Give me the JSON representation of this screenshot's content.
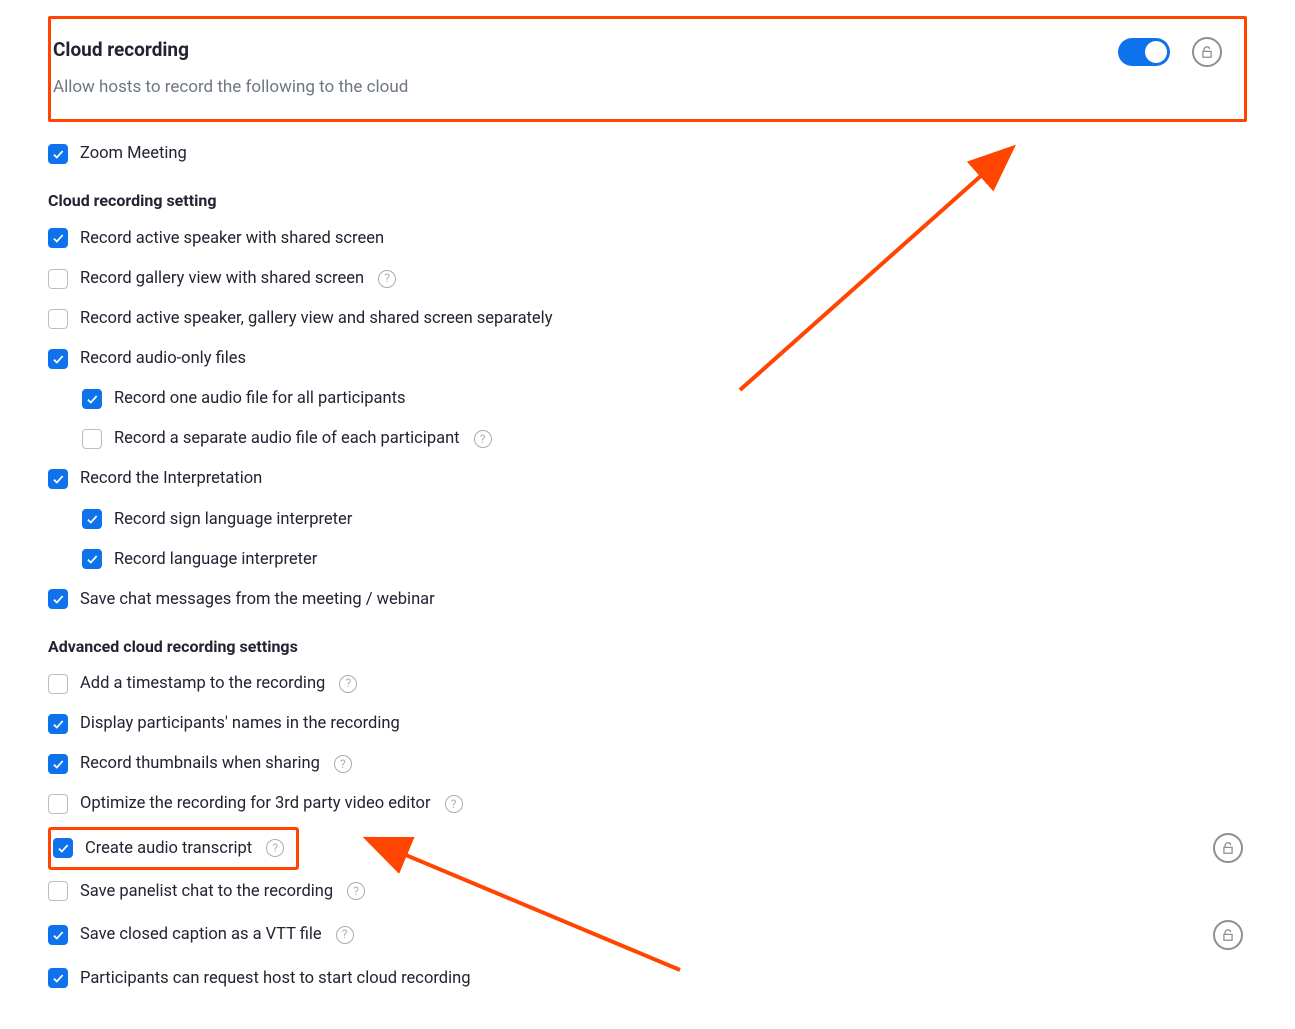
{
  "header": {
    "title": "Cloud recording",
    "desc": "Allow hosts to record the following to the cloud"
  },
  "zoom_meeting": {
    "label": "Zoom Meeting",
    "checked": true
  },
  "section1_heading": "Cloud recording setting",
  "section1": [
    {
      "label": "Record active speaker with shared screen",
      "checked": true,
      "help": false
    },
    {
      "label": "Record gallery view with shared screen",
      "checked": false,
      "help": true
    },
    {
      "label": "Record active speaker, gallery view and shared screen separately",
      "checked": false,
      "help": false
    },
    {
      "label": "Record audio-only files",
      "checked": true,
      "help": false,
      "children": [
        {
          "label": "Record one audio file for all participants",
          "checked": true,
          "help": false
        },
        {
          "label": "Record a separate audio file of each participant",
          "checked": false,
          "help": true
        }
      ]
    },
    {
      "label": "Record the Interpretation",
      "checked": true,
      "help": false,
      "children": [
        {
          "label": "Record sign language interpreter",
          "checked": true,
          "help": false
        },
        {
          "label": "Record language interpreter",
          "checked": true,
          "help": false
        }
      ]
    },
    {
      "label": "Save chat messages from the meeting / webinar",
      "checked": true,
      "help": false
    }
  ],
  "section2_heading": "Advanced cloud recording settings",
  "section2": [
    {
      "label": "Add a timestamp to the recording",
      "checked": false,
      "help": true
    },
    {
      "label": "Display participants' names in the recording",
      "checked": true,
      "help": false
    },
    {
      "label": "Record thumbnails when sharing",
      "checked": true,
      "help": true
    },
    {
      "label": "Optimize the recording for 3rd party video editor",
      "checked": false,
      "help": true
    },
    {
      "label": "Create audio transcript",
      "checked": true,
      "help": true,
      "highlight": true,
      "lock": true
    },
    {
      "label": "Save panelist chat to the recording",
      "checked": false,
      "help": true
    },
    {
      "label": "Save closed caption as a VTT file",
      "checked": true,
      "help": true,
      "lock": true
    },
    {
      "label": "Participants can request host to start cloud recording",
      "checked": true,
      "help": false
    }
  ]
}
